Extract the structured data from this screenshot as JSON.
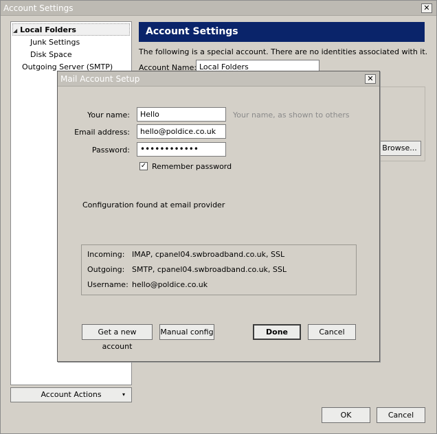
{
  "window": {
    "title": "Account Settings",
    "close_glyph": "✕"
  },
  "tree": {
    "items": [
      {
        "label": "Local Folders",
        "expanded": true
      },
      {
        "label": "Junk Settings"
      },
      {
        "label": "Disk Space"
      },
      {
        "label": "Outgoing Server (SMTP)"
      }
    ],
    "expand_glyph": "◢"
  },
  "account_actions": {
    "label": "Account Actions",
    "dropdown_glyph": "▾"
  },
  "panel": {
    "banner": "Account Settings",
    "special_text": "The following is a special account. There are no identities associated with it.",
    "account_name_label": "Account Name:",
    "account_name_value": "Local Folders",
    "browse_label": "Browse..."
  },
  "footer": {
    "ok_label": "OK",
    "cancel_label": "Cancel"
  },
  "dialog": {
    "title": "Mail Account Setup",
    "close_glyph": "✕",
    "name_label": "Your name:",
    "name_value": "Hello",
    "name_hint": "Your name, as shown to others",
    "email_label": "Email address:",
    "email_value": "hello@poldice.co.uk",
    "password_label": "Password:",
    "password_value": "••••••••••••",
    "remember_label": "Remember password",
    "remember_checked": true,
    "check_glyph": "✓",
    "config_status": "Configuration found at email provider",
    "incoming_label": "Incoming:",
    "incoming_value": "IMAP, cpanel04.swbroadband.co.uk, SSL",
    "outgoing_label": "Outgoing:",
    "outgoing_value": "SMTP, cpanel04.swbroadband.co.uk, SSL",
    "username_label": "Username:",
    "username_value": "hello@poldice.co.uk",
    "get_account_label": "Get a new account",
    "manual_config_label": "Manual config",
    "done_label": "Done",
    "cancel_label": "Cancel"
  },
  "colors": {
    "banner_bg": "#0a246a",
    "face": "#d4d0c8",
    "hint_text": "#8a8a8a"
  }
}
